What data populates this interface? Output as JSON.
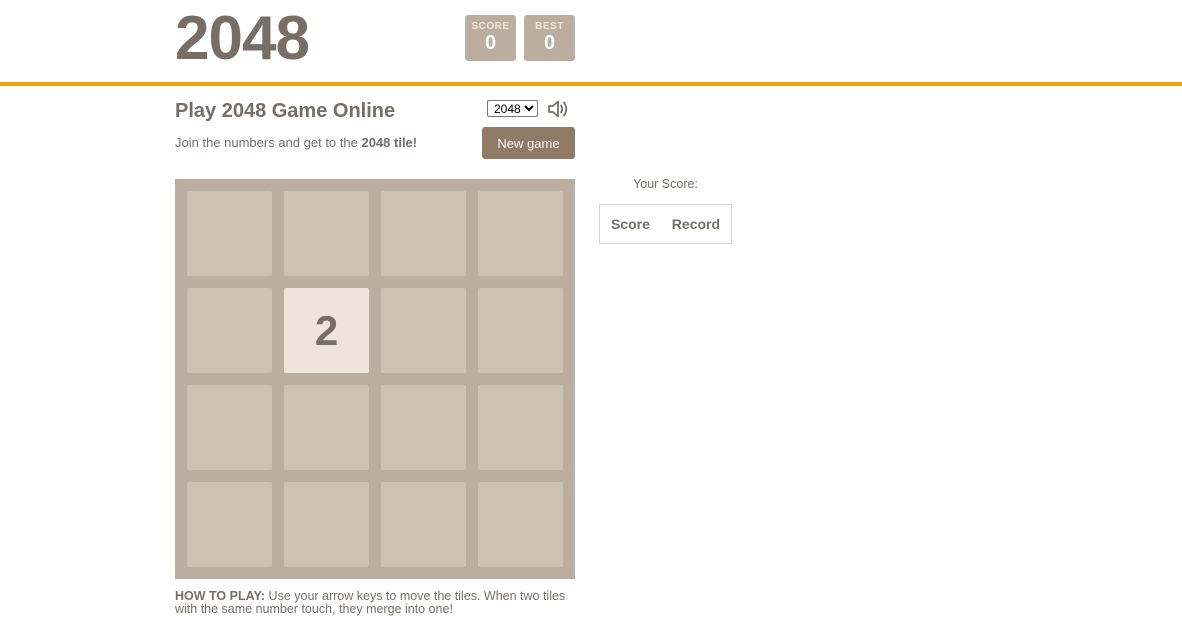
{
  "header": {
    "logo": "2048",
    "score": {
      "label": "SCORE",
      "value": "0"
    },
    "best": {
      "label": "BEST",
      "value": "0"
    }
  },
  "intro": {
    "title": "Play 2048 Game Online",
    "text_prefix": "Join the numbers and get to the ",
    "text_bold": "2048 tile!",
    "size_select": {
      "selected": "2048",
      "options": [
        "2048"
      ]
    },
    "new_game_label": "New game",
    "sound_icon": "speaker-icon"
  },
  "board": {
    "size": 4,
    "tiles": [
      [
        "",
        "",
        "",
        ""
      ],
      [
        "",
        "2",
        "",
        ""
      ],
      [
        "",
        "",
        "",
        ""
      ],
      [
        "",
        "",
        "",
        ""
      ]
    ]
  },
  "howto": {
    "label": "HOW TO PLAY:",
    "text": " Use your arrow keys to move the tiles. When two tiles with the same number touch, they merge into one!"
  },
  "side": {
    "your_score_label": "Your Score:",
    "columns": [
      "Score",
      "Record"
    ]
  },
  "colors": {
    "accent": "#f2a40c",
    "board_bg": "#bbada0",
    "cell_bg": "#cdc1b4",
    "tile_2": "#eee4da",
    "button_bg": "#8f7a66",
    "text": "#776e65"
  }
}
